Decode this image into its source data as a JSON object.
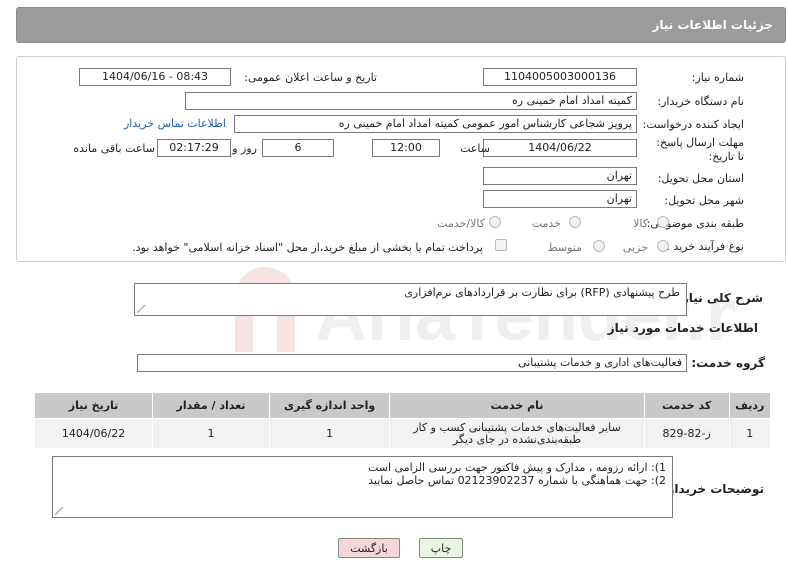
{
  "header": {
    "title": "جزئیات اطلاعات نیاز"
  },
  "form": {
    "need_number_label": "شماره نیاز:",
    "need_number": "1104005003000136",
    "announce_label": "تاریخ و ساعت اعلان عمومی:",
    "announce_value": "1404/06/16 - 08:43",
    "buyer_org_label": "نام دستگاه خریدار:",
    "buyer_org": "کمیته امداد امام خمینی ره",
    "creator_label": "ایجاد کننده درخواست:",
    "creator": "پرویز شجاعی کارشناس امور عمومی کمیته امداد امام خمینی ره",
    "contact_link": "اطلاعات تماس خریدار",
    "deadline_label": "مهلت ارسال پاسخ: تا تاریخ:",
    "deadline_date": "1404/06/22",
    "time_label": "ساعت",
    "deadline_time": "12:00",
    "days_value": "6",
    "days_label": "روز و",
    "remaining_time": "02:17:29",
    "remaining_label": "ساعت باقی مانده",
    "province_label": "استان محل تحویل:",
    "province": "تهران",
    "city_label": "شهر محل تحویل:",
    "city": "تهران",
    "category_label": "طبقه بندی موضوعی:",
    "category_options": [
      "کالا",
      "خدمت",
      "کالا/خدمت"
    ],
    "process_label": "نوع فرآیند خرید :",
    "process_options": [
      "جزیی",
      "متوسط"
    ],
    "payment_note": "پرداخت تمام یا بخشی از مبلغ خرید،از محل \"اسناد خزانه اسلامی\" خواهد بود."
  },
  "summary": {
    "label": "شرح کلی نیاز:",
    "text": "طرح پیشنهادی (RFP) برای نظارت بر قراردادهای نرم‌افزاری"
  },
  "services": {
    "section_title": "اطلاعات خدمات مورد نیاز",
    "group_label": "گروه خدمت:",
    "group_value": "فعالیت‌های اداری و خدمات پشتیبانی",
    "columns": [
      "ردیف",
      "کد خدمت",
      "نام خدمت",
      "واحد اندازه گیری",
      "تعداد / مقدار",
      "تاریخ نیاز"
    ],
    "rows": [
      {
        "index": "1",
        "code": "ز-82-829",
        "name": "سایر فعالیت‌های خدمات پشتیبانی کسب و کار طبقه‌بندی‌نشده در جای دیگر",
        "unit": "1",
        "qty": "1",
        "date": "1404/06/22"
      }
    ]
  },
  "buyer_notes": {
    "label": "توضیحات خریدار:",
    "lines": [
      "1): ارائه رزومه ، مدارک و پیش فاکتور جهت بررسی الزامی است",
      "2): جهت هماهنگی با شماره 02123902237 تماس حاصل نمایید"
    ]
  },
  "buttons": {
    "print": "چاپ",
    "back": "بازگشت"
  },
  "watermark": {
    "text": "AriaTender.neT"
  },
  "colors": {
    "header_bg": "#9b9b9b",
    "link": "#1a5fb4",
    "back_button_bg": "#f5d7d7",
    "print_button_bg": "#e8f5e1"
  }
}
